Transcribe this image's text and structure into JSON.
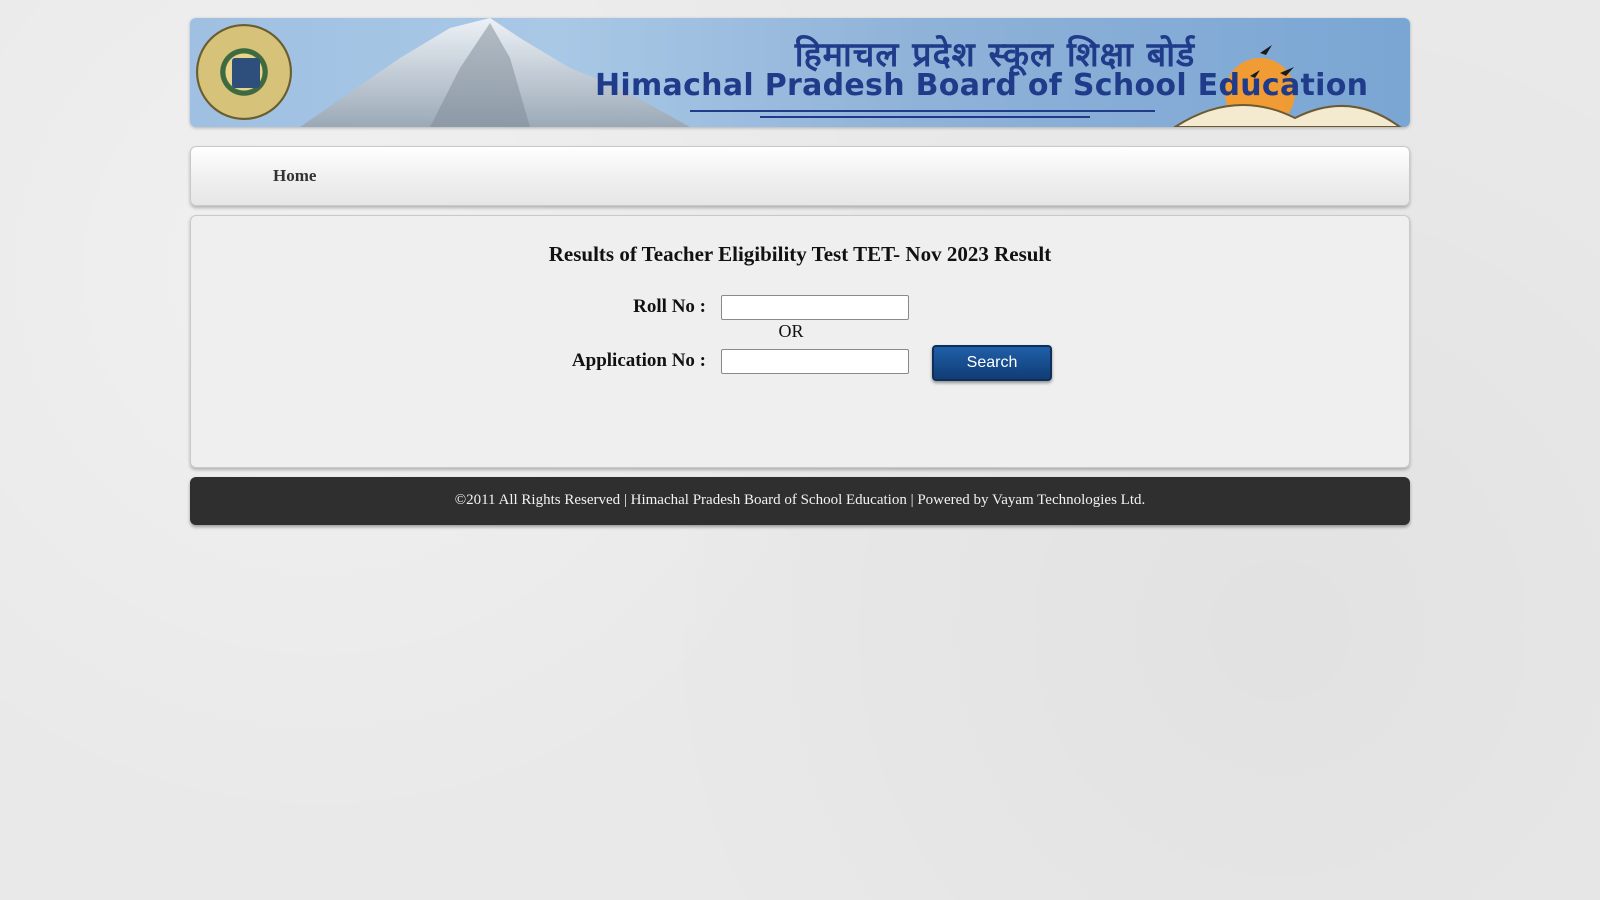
{
  "banner": {
    "hindi_title": "हिमाचल प्रदेश स्कूल शिक्षा बोर्ड",
    "english_title": "Himachal Pradesh Board of School Education",
    "logo_icon": "board-seal-icon"
  },
  "nav": {
    "home_label": "Home"
  },
  "main": {
    "title": "Results of Teacher Eligibility Test TET- Nov 2023 Result",
    "roll_label": "Roll No :",
    "roll_value": "",
    "or_label": "OR",
    "application_label": "Application No :",
    "application_value": "",
    "search_label": "Search"
  },
  "footer": {
    "text": "©2011 All Rights Reserved | Himachal Pradesh Board of School Education | Powered by Vayam Technologies Ltd."
  },
  "colors": {
    "banner_text": "#1f3b8a",
    "search_button": "#164a8a",
    "footer_bg": "#2f2f2f"
  }
}
